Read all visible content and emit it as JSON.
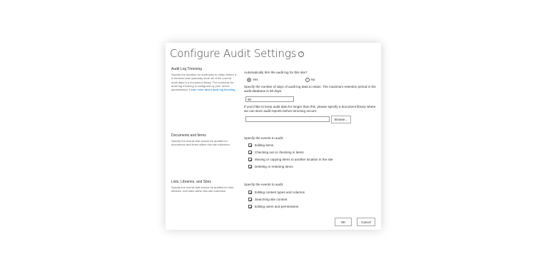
{
  "page": {
    "title": "Configure Audit Settings",
    "help_icon": "?"
  },
  "trimming": {
    "section_title": "Audit Log Trimming",
    "description": "Specify the duration for audit data to retain before it is trimmed and optionally store all of the current audit data in a document library. The schedule for audit log trimming is configured by your server administrator.",
    "link_text": "Learn more about audit log trimming.",
    "question": "Automatically trim the audit log for this site?",
    "options": [
      "Yes",
      "No"
    ],
    "selected": "Yes",
    "days_label": "Specify the number of days of audit log data to retain. The maximum retention period in the audit database is 90 days.",
    "days_value": "90",
    "library_label": "If you'd like to keep audit data for longer than this, please specify a document library where we can store audit reports before trimming occurs:",
    "library_value": "",
    "browse_label": "Browse..."
  },
  "documents": {
    "section_title": "Documents and Items",
    "description": "Specify the events that should be audited for documents and items within this site collection.",
    "events_label": "Specify the events to audit:",
    "events": [
      {
        "label": "Editing items",
        "checked": true
      },
      {
        "label": "Checking out or checking in items",
        "checked": true
      },
      {
        "label": "Moving or copying items to another location in the site",
        "checked": true
      },
      {
        "label": "Deleting or restoring items",
        "checked": true
      }
    ]
  },
  "lists": {
    "section_title": "Lists, Libraries, and Sites",
    "description": "Specify the events that should be audited for lists, libraries, and sites within this site collection.",
    "events_label": "Specify the events to audit:",
    "events": [
      {
        "label": "Editing content types and columns",
        "checked": true
      },
      {
        "label": "Searching site content",
        "checked": true
      },
      {
        "label": "Editing users and permissions",
        "checked": true
      }
    ]
  },
  "footer": {
    "ok_label": "OK",
    "cancel_label": "Cancel"
  }
}
